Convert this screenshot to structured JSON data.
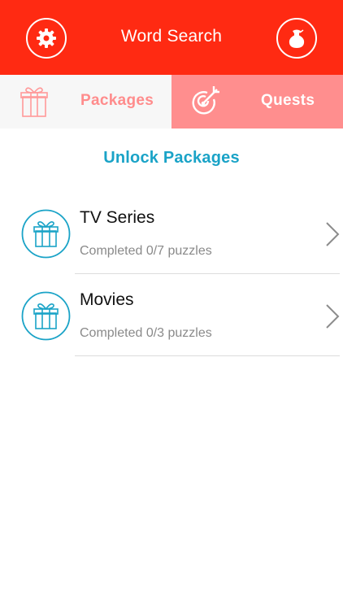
{
  "header": {
    "title": "Word Search"
  },
  "tabs": [
    {
      "label": "Packages",
      "icon": "gift-icon",
      "selected": true
    },
    {
      "label": "Quests",
      "icon": "target-icon",
      "selected": false
    }
  ],
  "section": {
    "title": "Unlock Packages"
  },
  "packages": [
    {
      "title": "TV Series",
      "status": "Completed 0/7 puzzles",
      "icon": "gift-icon"
    },
    {
      "title": "Movies",
      "status": "Completed 0/3 puzzles",
      "icon": "gift-icon"
    }
  ],
  "colors": {
    "header_bg": "#ff2a12",
    "tab_active_bg": "#f7f7f7",
    "tab_inactive_bg": "#ff8e8e",
    "accent": "#1aa3c7"
  }
}
